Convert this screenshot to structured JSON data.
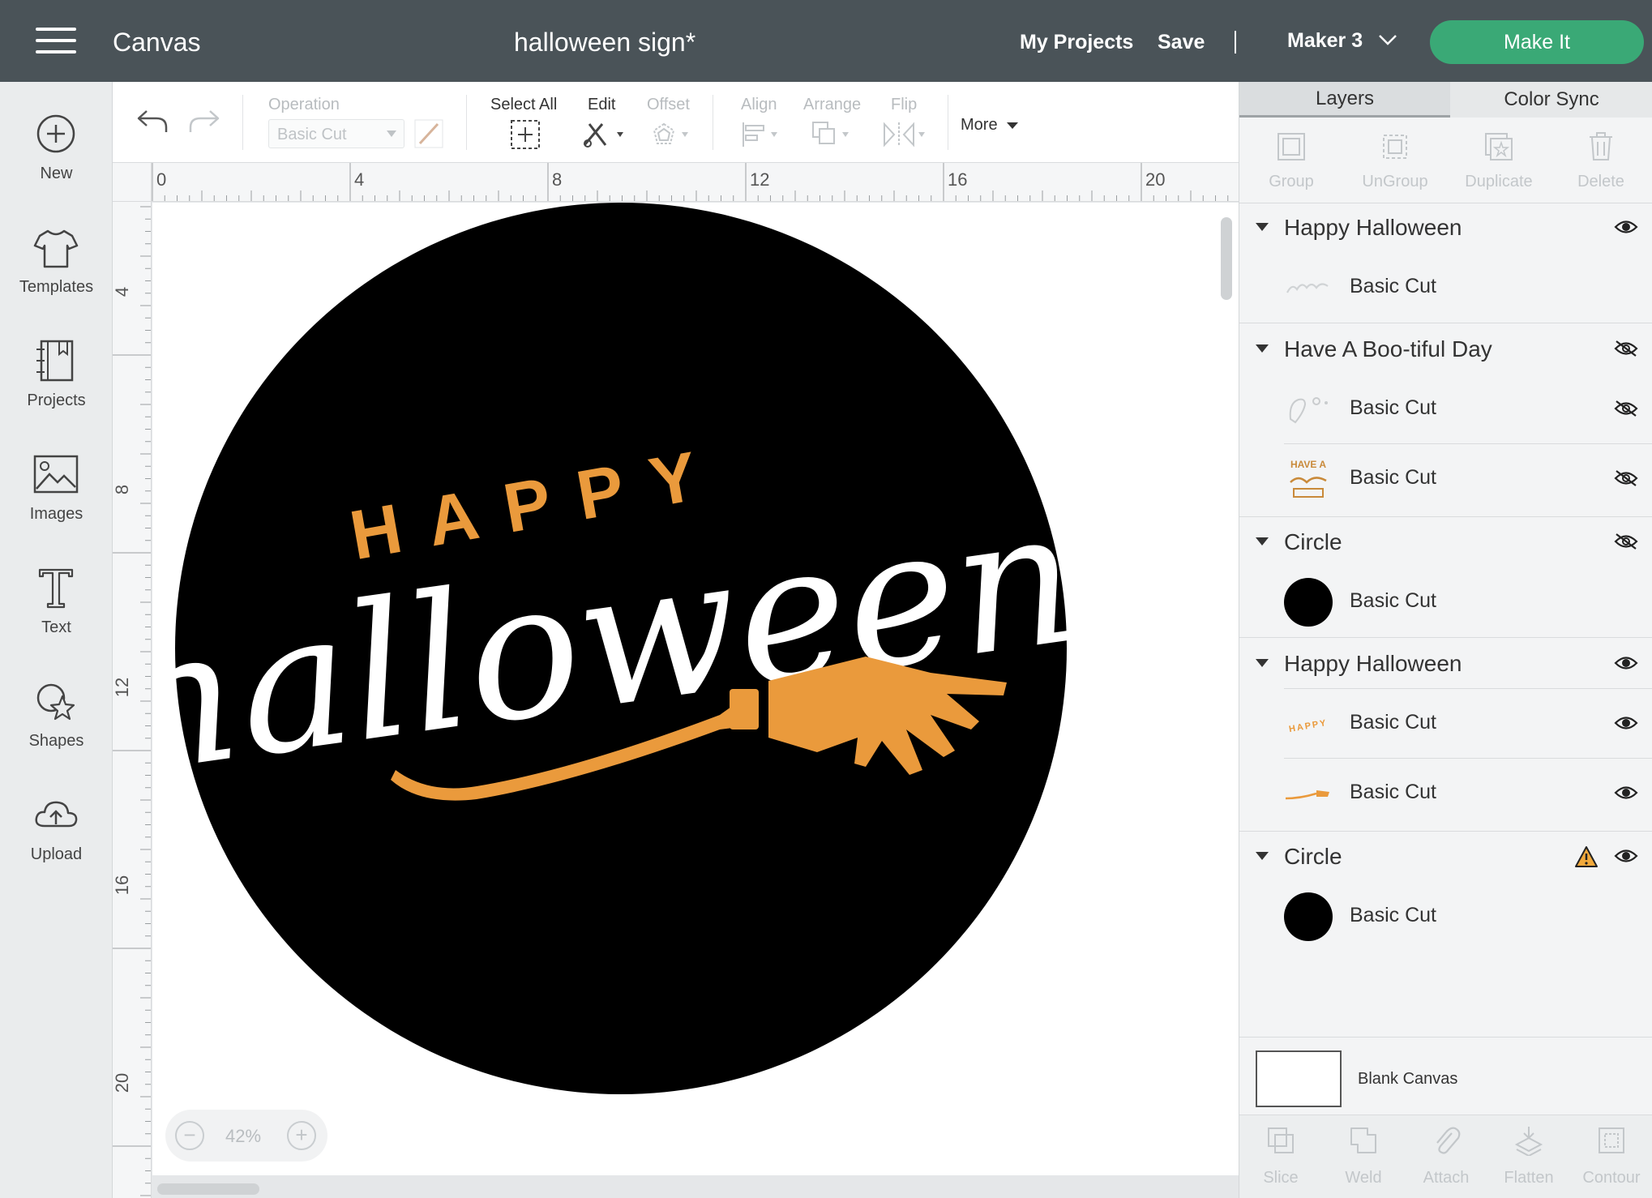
{
  "header": {
    "app_title": "Canvas",
    "document_title": "halloween sign*",
    "my_projects": "My Projects",
    "save": "Save",
    "machine": "Maker 3",
    "make_it": "Make It",
    "bg_color": "#4a5358",
    "make_it_color": "#3aa976"
  },
  "sidebar": {
    "items": [
      {
        "label": "New",
        "icon": "plus-circle-icon"
      },
      {
        "label": "Templates",
        "icon": "tshirt-icon"
      },
      {
        "label": "Projects",
        "icon": "notebook-icon"
      },
      {
        "label": "Images",
        "icon": "image-icon"
      },
      {
        "label": "Text",
        "icon": "text-t-icon"
      },
      {
        "label": "Shapes",
        "icon": "shapes-icon"
      },
      {
        "label": "Upload",
        "icon": "cloud-upload-icon"
      }
    ]
  },
  "toolbar": {
    "undo_icon": "undo-icon",
    "redo_icon": "redo-icon",
    "operation_label": "Operation",
    "operation_value": "Basic Cut",
    "select_all": "Select All",
    "edit": "Edit",
    "offset": "Offset",
    "align": "Align",
    "arrange": "Arrange",
    "flip": "Flip",
    "more": "More"
  },
  "rulers": {
    "top": [
      "0",
      "4",
      "8",
      "12",
      "16",
      "20"
    ],
    "left": [
      "4",
      "8",
      "12",
      "16",
      "20"
    ]
  },
  "canvas": {
    "design": {
      "circle_color": "#000000",
      "happy_text": "HAPPY",
      "script_text": "halloween",
      "accent_color": "#ea9a3c",
      "text_color": "#ffffff"
    },
    "zoom": {
      "minus": "−",
      "level": "42%",
      "plus": "+"
    }
  },
  "right_panel": {
    "tabs": {
      "layers": "Layers",
      "color_sync": "Color Sync"
    },
    "actions": {
      "group": "Group",
      "ungroup": "UnGroup",
      "duplicate": "Duplicate",
      "delete": "Delete"
    },
    "groups": [
      {
        "title": "Happy Halloween",
        "visible": true,
        "layers": [
          {
            "name": "Basic Cut",
            "thumb": "halloween-script-thumb"
          }
        ]
      },
      {
        "title": "Have A Boo-tiful Day",
        "visible": false,
        "layers": [
          {
            "name": "Basic Cut",
            "thumb": "ghost-outline-thumb",
            "visible": false
          },
          {
            "name": "Basic Cut",
            "thumb": "have-a-bootiful-day-thumb",
            "thumb_text": "HAVE A",
            "visible": false
          }
        ]
      },
      {
        "title": "Circle",
        "visible": false,
        "layers": [
          {
            "name": "Basic Cut",
            "thumb": "black-circle-thumb"
          }
        ]
      },
      {
        "title": "Happy Halloween",
        "visible": true,
        "layers": [
          {
            "name": "Basic Cut",
            "thumb": "happy-letters-thumb",
            "thumb_text": "HAPPY",
            "visible": true
          },
          {
            "name": "Basic Cut",
            "thumb": "broom-thumb",
            "visible": true
          }
        ]
      },
      {
        "title": "Circle",
        "visible": true,
        "warning": true,
        "layers": [
          {
            "name": "Basic Cut",
            "thumb": "black-circle-thumb"
          }
        ]
      }
    ],
    "blank_canvas": "Blank Canvas",
    "bottom_actions": {
      "slice": "Slice",
      "weld": "Weld",
      "attach": "Attach",
      "flatten": "Flatten",
      "contour": "Contour"
    }
  }
}
